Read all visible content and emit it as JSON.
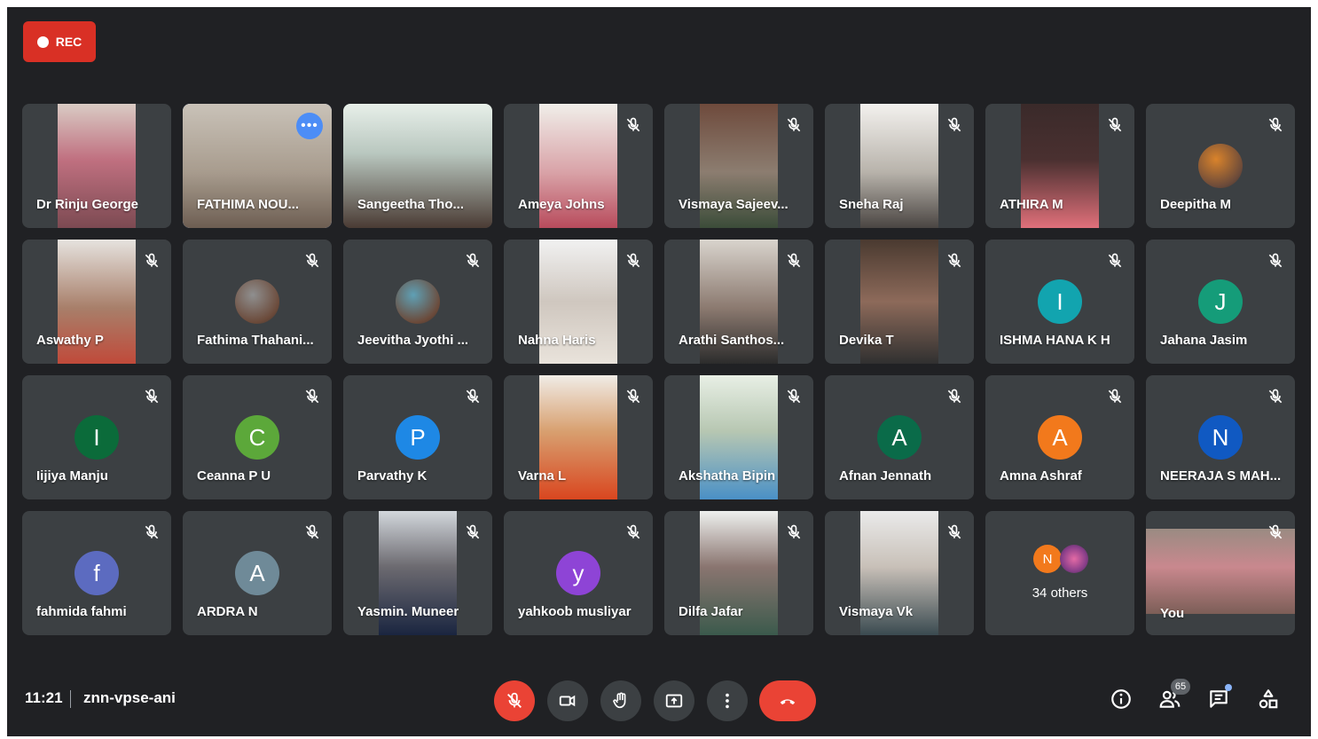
{
  "recording": {
    "label": "REC"
  },
  "meeting": {
    "time": "11:21",
    "code": "znn-vpse-ani"
  },
  "participant_count": "65",
  "others": {
    "label": "34 others",
    "initial": "N"
  },
  "colors": {
    "background": "#202124",
    "tile": "#3c4043",
    "danger": "#ea4335",
    "active_border": "#8ab4f8"
  },
  "tiles": [
    {
      "name": "Dr Rinju George",
      "kind": "video",
      "video": "v1",
      "muted": false
    },
    {
      "name": "FATHIMA NOU...",
      "kind": "video",
      "video": "full",
      "muted": false,
      "active": true
    },
    {
      "name": "Sangeetha Tho...",
      "kind": "video",
      "video": "v3",
      "muted": false
    },
    {
      "name": "Ameya Johns",
      "kind": "video",
      "video": "v4",
      "muted": true
    },
    {
      "name": "Vismaya Sajeev...",
      "kind": "video",
      "video": "v5",
      "muted": true
    },
    {
      "name": "Sneha Raj",
      "kind": "video",
      "video": "v6",
      "muted": true
    },
    {
      "name": "ATHIRA M",
      "kind": "video",
      "video": "v7",
      "muted": true
    },
    {
      "name": "Deepitha M",
      "kind": "photo",
      "avatar_color": "#d9832b",
      "muted": true
    },
    {
      "name": "Aswathy P",
      "kind": "video",
      "video": "v9",
      "muted": true
    },
    {
      "name": "Fathima Thahani...",
      "kind": "photo",
      "avatar_color": "#8f8f8f",
      "muted": true
    },
    {
      "name": "Jeevitha Jyothi ...",
      "kind": "photo",
      "avatar_color": "#5fa0b5",
      "muted": true
    },
    {
      "name": "Nahna Haris",
      "kind": "video",
      "video": "v12",
      "muted": true
    },
    {
      "name": "Arathi Santhos...",
      "kind": "video",
      "video": "v13",
      "muted": true
    },
    {
      "name": "Devika T",
      "kind": "video",
      "video": "v14",
      "muted": true
    },
    {
      "name": "ISHMA HANA K H",
      "kind": "initial",
      "initial": "I",
      "avatar_color": "#12a4af",
      "muted": true
    },
    {
      "name": "Jahana Jasim",
      "kind": "initial",
      "initial": "J",
      "avatar_color": "#159c79",
      "muted": true
    },
    {
      "name": "Iijiya Manju",
      "kind": "initial",
      "initial": "I",
      "avatar_color": "#0b6b3a",
      "muted": true
    },
    {
      "name": "Ceanna P U",
      "kind": "initial",
      "initial": "C",
      "avatar_color": "#5ca83a",
      "muted": true
    },
    {
      "name": "Parvathy K",
      "kind": "initial",
      "initial": "P",
      "avatar_color": "#1e88e5",
      "muted": true
    },
    {
      "name": "Varna L",
      "kind": "video",
      "video": "v20",
      "muted": true
    },
    {
      "name": "Akshatha Bipin",
      "kind": "video",
      "video": "v21",
      "muted": true
    },
    {
      "name": "Afnan Jennath",
      "kind": "initial",
      "initial": "A",
      "avatar_color": "#0a6b49",
      "muted": true
    },
    {
      "name": "Amna Ashraf",
      "kind": "initial",
      "initial": "A",
      "avatar_color": "#f2791c",
      "muted": true
    },
    {
      "name": "NEERAJA S MAH...",
      "kind": "initial",
      "initial": "N",
      "avatar_color": "#1059c2",
      "muted": true
    },
    {
      "name": "fahmida fahmi",
      "kind": "initial",
      "initial": "f",
      "avatar_color": "#5c6bc0",
      "muted": true
    },
    {
      "name": "ARDRA N",
      "kind": "initial",
      "initial": "A",
      "avatar_color": "#6f8a98",
      "muted": true
    },
    {
      "name": "Yasmin. Muneer",
      "kind": "video",
      "video": "v27",
      "muted": true
    },
    {
      "name": "yahkoob musliyar",
      "kind": "initial",
      "initial": "y",
      "avatar_color": "#8e44d6",
      "muted": true
    },
    {
      "name": "Dilfa Jafar",
      "kind": "video",
      "video": "v29",
      "muted": true
    },
    {
      "name": "Vismaya Vk",
      "kind": "video",
      "video": "v30",
      "muted": true
    },
    {
      "name": "",
      "kind": "others",
      "muted": false
    },
    {
      "name": "You",
      "kind": "self",
      "muted": true
    }
  ],
  "controls": {
    "mic": "mic-off-icon",
    "camera": "camera-icon",
    "hand": "raise-hand-icon",
    "present": "present-screen-icon",
    "more": "more-options-icon",
    "end": "end-call-icon",
    "info": "info-icon",
    "people": "people-icon",
    "chat": "chat-icon",
    "activities": "activities-icon"
  }
}
